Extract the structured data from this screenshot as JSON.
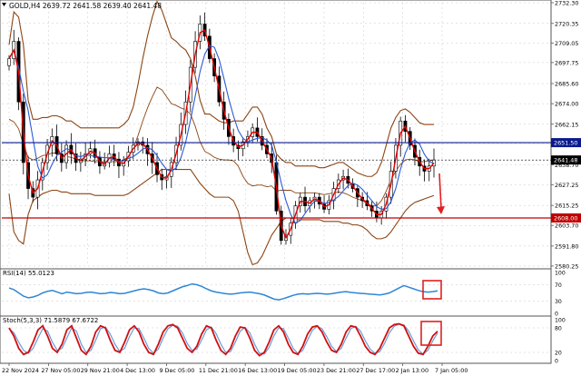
{
  "header": {
    "symbol_info": "GOLD,H4  2639.72 2641.58 2639.40 2641.48"
  },
  "colors": {
    "background": "#ffffff",
    "candles": "#000000",
    "grid": "#c8c8c8",
    "bollinger": "#8b4513",
    "ma_fast": "#e00000",
    "ma_slow": "#2a5bd7",
    "resistance_line": "#0b1a8c",
    "support_line": "#c00000",
    "rsi_line": "#2f86d6",
    "stoch_main": "#d01010",
    "stoch_signal": "#6a9bd8",
    "arrow": "#e02020",
    "highlight_box": "#e02020"
  },
  "chart_data": [
    {
      "type": "line",
      "panel": "price",
      "title": "GOLD,H4",
      "ohlc_readout": [
        "2639.72",
        "2641.58",
        "2639.40",
        "2641.48"
      ],
      "ylim": [
        2580.2,
        2732.3
      ],
      "y_ticks": [
        "2732.30",
        "2720.35",
        "2709.05",
        "2697.75",
        "2685.60",
        "2674.00",
        "2662.15",
        "2650.85",
        "2638.70",
        "2627.25",
        "2615.25",
        "2603.70",
        "2591.80",
        "2580.25"
      ],
      "x_ticks": [
        "22 Nov 2024",
        "27 Nov 05:00",
        "29 Nov 21:00",
        "4 Dec 13:00",
        "9 Dec 05:00",
        "11 Dec 21:00",
        "16 Dec 13:00",
        "19 Dec 05:00",
        "23 Dec 21:00",
        "27 Dec 17:00",
        "2 Jan 13:00",
        "7 Jan 05:00"
      ],
      "current_price": 2641.48,
      "current_price_label": "2641.48",
      "resistance": 2651.5,
      "resistance_label": "2651.50",
      "support": 2608.0,
      "support_label": "2608.00",
      "close_series": [
        2700,
        2710,
        2675,
        2640,
        2625,
        2620,
        2630,
        2640,
        2650,
        2655,
        2645,
        2640,
        2650,
        2645,
        2640,
        2642,
        2645,
        2648,
        2643,
        2638,
        2640,
        2645,
        2642,
        2638,
        2641,
        2646,
        2650,
        2652,
        2650,
        2645,
        2640,
        2633,
        2630,
        2632,
        2640,
        2650,
        2662,
        2675,
        2695,
        2710,
        2720,
        2713,
        2700,
        2690,
        2675,
        2665,
        2655,
        2650,
        2648,
        2652,
        2655,
        2660,
        2655,
        2650,
        2645,
        2640,
        2612,
        2595,
        2598,
        2605,
        2615,
        2620,
        2615,
        2618,
        2620,
        2616,
        2613,
        2618,
        2625,
        2630,
        2632,
        2628,
        2625,
        2620,
        2618,
        2615,
        2612,
        2608,
        2612,
        2620,
        2635,
        2650,
        2664,
        2658,
        2650,
        2643,
        2638,
        2635,
        2638,
        2641.5
      ],
      "bollinger_upper": [
        2708,
        2727,
        2724,
        2708,
        2676,
        2665,
        2665,
        2666,
        2666,
        2667,
        2667,
        2666,
        2664,
        2664,
        2662,
        2660,
        2660,
        2660,
        2660,
        2660,
        2660,
        2660,
        2660,
        2660,
        2662,
        2665,
        2672,
        2685,
        2700,
        2713,
        2724,
        2733,
        2728,
        2720,
        2712,
        2710,
        2707,
        2705,
        2700,
        2690,
        2676,
        2668,
        2668,
        2666,
        2664,
        2663,
        2663,
        2664,
        2664,
        2664,
        2668,
        2672,
        2672,
        2668,
        2660,
        2655,
        2645,
        2642,
        2640,
        2640,
        2638,
        2638,
        2638,
        2638,
        2638,
        2637,
        2637,
        2638,
        2639,
        2640,
        2640,
        2638,
        2636,
        2634,
        2633,
        2632,
        2632,
        2634,
        2640,
        2650,
        2660,
        2666,
        2670,
        2671,
        2669,
        2666,
        2663,
        2662,
        2662,
        2662
      ],
      "bollinger_lower": [
        2622,
        2600,
        2595,
        2593,
        2610,
        2618,
        2620,
        2622,
        2623,
        2624,
        2624,
        2623,
        2623,
        2622,
        2622,
        2622,
        2622,
        2622,
        2621,
        2621,
        2621,
        2621,
        2621,
        2621,
        2621,
        2622,
        2624,
        2626,
        2628,
        2630,
        2632,
        2634,
        2636,
        2636,
        2636,
        2636,
        2636,
        2636,
        2636,
        2632,
        2628,
        2625,
        2622,
        2620,
        2620,
        2620,
        2620,
        2618,
        2612,
        2600,
        2588,
        2581,
        2582,
        2586,
        2592,
        2598,
        2602,
        2606,
        2608,
        2608,
        2607,
        2607,
        2607,
        2607,
        2607,
        2607,
        2606,
        2606,
        2606,
        2606,
        2605,
        2605,
        2604,
        2604,
        2603,
        2601,
        2598,
        2596,
        2596,
        2597,
        2600,
        2604,
        2608,
        2612,
        2615,
        2617,
        2618,
        2619,
        2620,
        2621
      ],
      "y_label": "",
      "x_label": ""
    },
    {
      "type": "line",
      "panel": "rsi",
      "title": "RSI(14) 55.0123",
      "ylim": [
        0,
        100
      ],
      "y_ticks": [
        "100",
        "70",
        "30",
        "0"
      ],
      "levels": [
        30,
        70
      ],
      "values": [
        62,
        58,
        50,
        42,
        38,
        40,
        44,
        50,
        54,
        56,
        52,
        48,
        52,
        50,
        48,
        49,
        51,
        52,
        50,
        48,
        49,
        51,
        50,
        48,
        49,
        52,
        55,
        58,
        60,
        58,
        55,
        50,
        48,
        50,
        55,
        60,
        65,
        68,
        72,
        70,
        66,
        60,
        55,
        52,
        50,
        48,
        47,
        48,
        50,
        51,
        52,
        50,
        48,
        45,
        40,
        35,
        33,
        36,
        40,
        44,
        47,
        48,
        47,
        48,
        49,
        48,
        47,
        48,
        50,
        52,
        53,
        51,
        50,
        49,
        48,
        47,
        46,
        45,
        47,
        50,
        56,
        62,
        68,
        64,
        60,
        56,
        53,
        52,
        53,
        55.0123
      ]
    },
    {
      "type": "line",
      "panel": "stochastic",
      "title": "Stoch(5,3,3) 71.5879 67.6722",
      "ylim": [
        0,
        100
      ],
      "y_ticks": [
        "100",
        "80",
        "20",
        "0"
      ],
      "levels": [
        20,
        80
      ],
      "series": [
        {
          "values": [
            80,
            60,
            30,
            15,
            20,
            45,
            75,
            85,
            60,
            30,
            20,
            40,
            75,
            85,
            55,
            25,
            15,
            35,
            70,
            85,
            80,
            50,
            25,
            20,
            45,
            75,
            85,
            70,
            40,
            20,
            15,
            40,
            70,
            85,
            88,
            80,
            55,
            30,
            20,
            35,
            65,
            85,
            80,
            50,
            25,
            15,
            30,
            60,
            82,
            80,
            55,
            25,
            12,
            20,
            45,
            75,
            85,
            70,
            40,
            20,
            15,
            35,
            65,
            82,
            85,
            70,
            45,
            25,
            20,
            40,
            70,
            85,
            82,
            60,
            35,
            20,
            15,
            30,
            55,
            80,
            88,
            90,
            85,
            60,
            35,
            18,
            15,
            35,
            60,
            71.5879
          ]
        },
        {
          "values": [
            78,
            68,
            45,
            25,
            18,
            30,
            55,
            78,
            72,
            45,
            25,
            30,
            55,
            80,
            72,
            40,
            20,
            25,
            50,
            78,
            82,
            65,
            40,
            22,
            30,
            58,
            80,
            78,
            55,
            30,
            18,
            28,
            55,
            78,
            86,
            84,
            68,
            42,
            25,
            28,
            50,
            75,
            82,
            66,
            40,
            20,
            22,
            45,
            72,
            81,
            68,
            40,
            18,
            16,
            32,
            60,
            80,
            78,
            55,
            30,
            17,
            25,
            50,
            74,
            84,
            78,
            58,
            35,
            22,
            30,
            55,
            78,
            84,
            72,
            48,
            28,
            18,
            22,
            42,
            68,
            84,
            89,
            87,
            72,
            48,
            26,
            16,
            25,
            48,
            67.6722
          ]
        }
      ]
    }
  ]
}
